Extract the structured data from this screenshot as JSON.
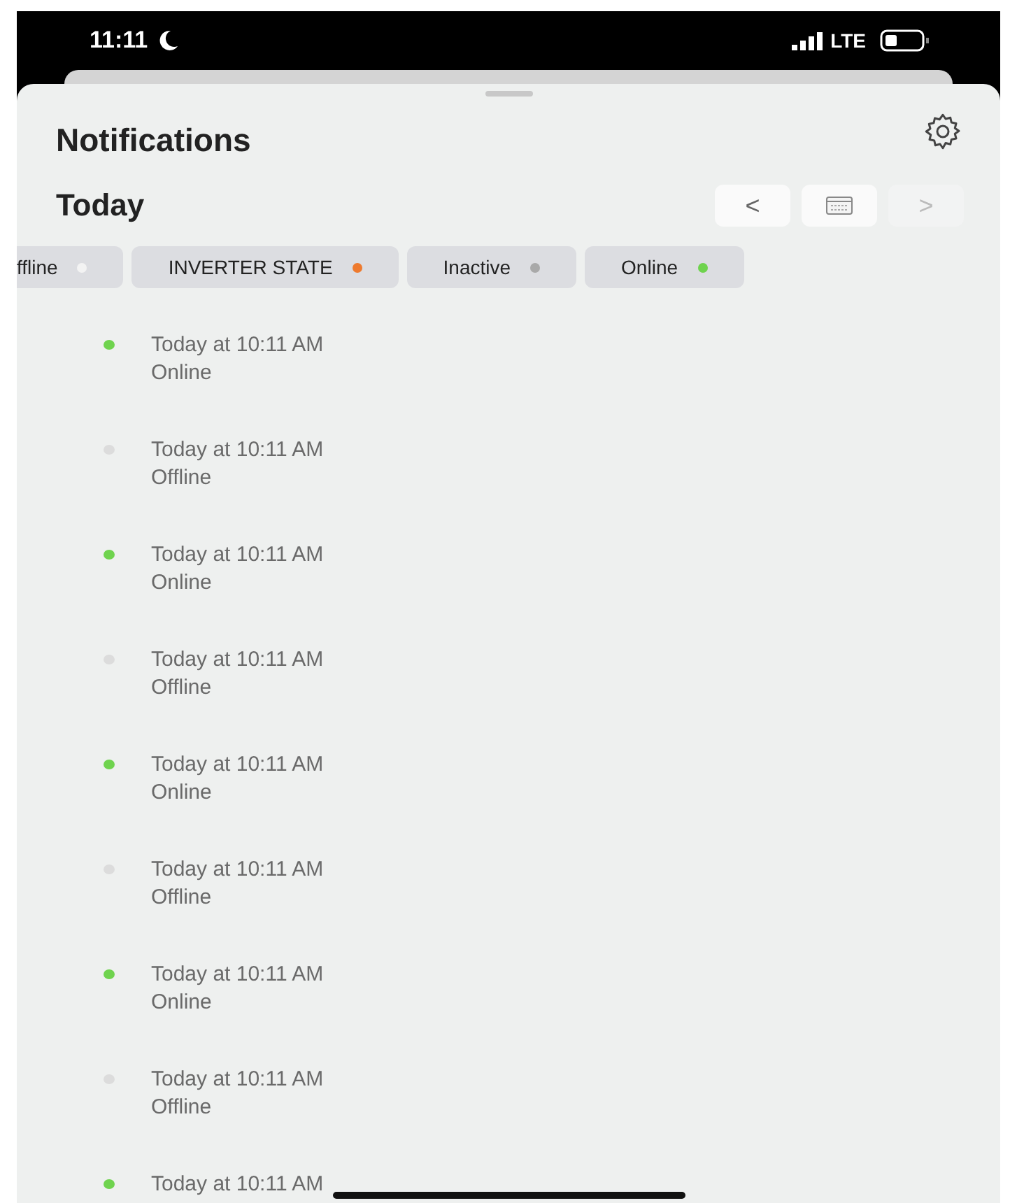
{
  "status_bar": {
    "time": "11:11",
    "network": "LTE"
  },
  "header": {
    "title": "Notifications"
  },
  "day": {
    "label": "Today",
    "prev": "<",
    "next": ">"
  },
  "filters": [
    {
      "label": "ffline",
      "color": "#f3f3f3",
      "selected": false
    },
    {
      "label": "INVERTER STATE",
      "color": "#ee7a2e",
      "selected": false
    },
    {
      "label": "Inactive",
      "color": "#a9a9a9",
      "selected": false
    },
    {
      "label": "Online",
      "color": "#6fd34e",
      "selected": false
    }
  ],
  "notifications": [
    {
      "time": "Today at 10:11 AM",
      "status": "Online",
      "color": "#6fd34e"
    },
    {
      "time": "Today at 10:11 AM",
      "status": "Offline",
      "color": "#dcdcdc"
    },
    {
      "time": "Today at 10:11 AM",
      "status": "Online",
      "color": "#6fd34e"
    },
    {
      "time": "Today at 10:11 AM",
      "status": "Offline",
      "color": "#dcdcdc"
    },
    {
      "time": "Today at 10:11 AM",
      "status": "Online",
      "color": "#6fd34e"
    },
    {
      "time": "Today at 10:11 AM",
      "status": "Offline",
      "color": "#dcdcdc"
    },
    {
      "time": "Today at 10:11 AM",
      "status": "Online",
      "color": "#6fd34e"
    },
    {
      "time": "Today at 10:11 AM",
      "status": "Offline",
      "color": "#dcdcdc"
    },
    {
      "time": "Today at 10:11 AM",
      "color": "#6fd34e"
    }
  ]
}
